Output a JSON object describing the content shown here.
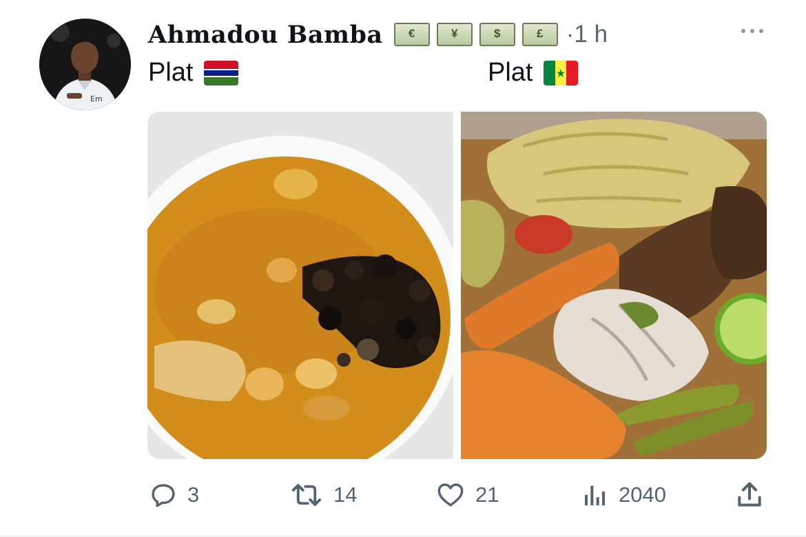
{
  "post": {
    "author": "Ahmadou Bamba",
    "badges": [
      "€",
      "¥",
      "$",
      "£"
    ],
    "separator": "·",
    "time": "1 h",
    "caption_left": "Plat",
    "caption_right": "Plat",
    "flag_left": "gambia-flag",
    "flag_right": "senegal-flag"
  },
  "actions": {
    "replies": "3",
    "reposts": "14",
    "likes": "21",
    "views": "2040"
  },
  "icons": {
    "reply": "reply-icon",
    "repost": "repost-icon",
    "like": "heart-icon",
    "views": "views-icon",
    "share": "share-icon",
    "more": "more-icon"
  },
  "colors": {
    "text": "#0f1419",
    "secondary": "#536471"
  }
}
